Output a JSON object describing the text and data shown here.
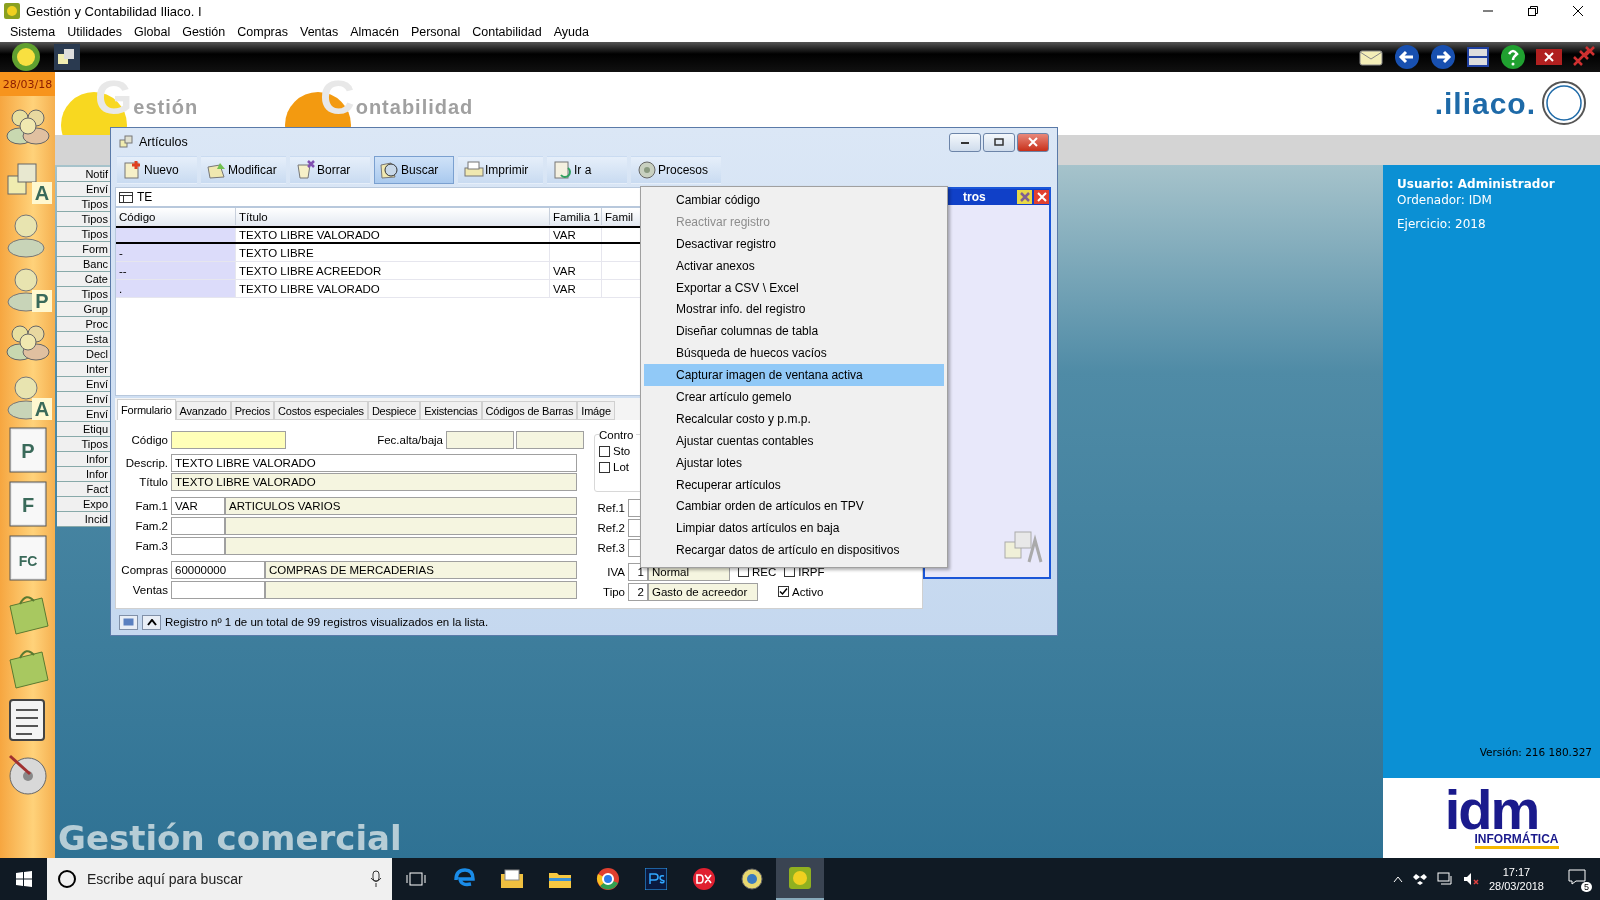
{
  "app_window": {
    "title": "Gestión y Contabilidad Iliaco. I"
  },
  "menu_bar": [
    "Sistema",
    "Utilidades",
    "Global",
    "Gestión",
    "Compras",
    "Ventas",
    "Almacén",
    "Personal",
    "Contabilidad",
    "Ayuda"
  ],
  "date": "28/03/18",
  "sidebar": [
    {
      "kind": "people"
    },
    {
      "kind": "cube",
      "letter": "A"
    },
    {
      "kind": "person"
    },
    {
      "kind": "person",
      "letter": "P"
    },
    {
      "kind": "people"
    },
    {
      "kind": "person",
      "letter": "A"
    },
    {
      "kind": "page",
      "letter": "P"
    },
    {
      "kind": "page",
      "letter": "F"
    },
    {
      "kind": "page",
      "letter": "FC"
    },
    {
      "kind": "bag"
    },
    {
      "kind": "bag"
    },
    {
      "kind": "list"
    },
    {
      "kind": "disc"
    }
  ],
  "header": {
    "logo_1": "Gestión",
    "logo_2": "Contabilidad",
    "brand": ".iliaco."
  },
  "background_list": [
    "Notif",
    "Enví",
    "Tipos",
    "Tipos",
    "Tipos",
    "Form",
    "Banc",
    "Cate",
    "Tipos",
    "Grup",
    "Proc",
    "Esta",
    "Decl",
    "Inter",
    "Enví",
    "Enví",
    "Enví",
    "Etiqu",
    "Tipos",
    "Infor",
    "Infor",
    "Fact",
    "Expo",
    "Incid"
  ],
  "info": {
    "user": "Usuario: Administrador",
    "computer": "Ordenador: IDM",
    "year": "Ejercicio: 2018",
    "version": "Versión: 216 180.327"
  },
  "company_logo": {
    "name": "idm",
    "tagline": "INFORMÁTICA"
  },
  "footer_title": "Gestión comercial",
  "articles_window": {
    "title": "Artículos",
    "toolbar": [
      {
        "label": "Nuevo",
        "kind": "new",
        "selected": false
      },
      {
        "label": "Modificar",
        "kind": "edit",
        "selected": false
      },
      {
        "label": "Borrar",
        "kind": "delete",
        "selected": false
      },
      {
        "label": "Buscar",
        "kind": "search",
        "selected": true
      },
      {
        "label": "Imprimir",
        "kind": "print",
        "selected": false
      },
      {
        "label": "Ir a",
        "kind": "goto",
        "selected": false
      },
      {
        "label": "Procesos",
        "kind": "gear",
        "selected": false
      }
    ],
    "search": {
      "value": "TE"
    },
    "table": {
      "columns": [
        "Código",
        "Título",
        "Familia 1",
        "Famil"
      ],
      "rows": [
        {
          "title": "TEXTO LIBRE VALORADO",
          "family": "VAR",
          "selected": true
        },
        {
          "code": "-",
          "title": "TEXTO LIBRE",
          "selected": false
        },
        {
          "code": "--",
          "title": "TEXTO LIBRE ACREEDOR",
          "family": "VAR",
          "selected": false
        },
        {
          "code": ".",
          "title": "TEXTO LIBRE VALORADO",
          "family": "VAR",
          "selected": false
        }
      ]
    },
    "tabs": [
      {
        "label": "Formulario",
        "selected": true
      },
      {
        "label": "Avanzado",
        "selected": false
      },
      {
        "label": "Precios",
        "selected": false
      },
      {
        "label": "Costos especiales",
        "selected": false
      },
      {
        "label": "Despiece",
        "selected": false
      },
      {
        "label": "Existencias",
        "selected": false
      },
      {
        "label": "Códigos de Barras",
        "selected": false
      },
      {
        "label": "Imáge",
        "selected": false
      }
    ],
    "form": {
      "code": {
        "label": "Código"
      },
      "dates": {
        "label": "Fec.alta/baja"
      },
      "description": {
        "label": "Descrip.",
        "value": "TEXTO LIBRE VALORADO"
      },
      "title": {
        "label": "Título",
        "value": "TEXTO LIBRE VALORADO"
      },
      "families": [
        {
          "label": "Fam.1",
          "code": "VAR",
          "name": "ARTICULOS VARIOS"
        },
        {
          "label": "Fam.2"
        },
        {
          "label": "Fam.3"
        }
      ],
      "accounts": [
        {
          "label": "Compras",
          "code": "60000000",
          "name": "COMPRAS DE MERCADERIAS"
        },
        {
          "label": "Ventas"
        }
      ],
      "control": {
        "title": "Contro",
        "checks": [
          {
            "label": "Sto",
            "checked": false
          },
          {
            "label": "Lot",
            "checked": false
          }
        ]
      },
      "refs": [
        "Ref.1",
        "Ref.2",
        "Ref.3"
      ],
      "iva": {
        "label": "IVA",
        "code": "1",
        "name": "Normal",
        "flags": [
          {
            "label": "REC",
            "checked": false
          },
          {
            "label": "IRPF",
            "checked": false
          }
        ]
      },
      "type": {
        "label": "Tipo",
        "code": "2",
        "name": "Gasto de acreedor",
        "flags": [
          {
            "label": "Activo",
            "checked": true
          }
        ]
      }
    },
    "status": "Registro nº 1 de un total de 99 registros visualizados en la lista.",
    "side_panel": {
      "title": "tros"
    }
  },
  "context_menu": [
    {
      "label": "Cambiar código",
      "disabled": false,
      "selected": false
    },
    {
      "label": "Reactivar registro",
      "disabled": true,
      "selected": false
    },
    {
      "label": "Desactivar registro",
      "disabled": false,
      "selected": false
    },
    {
      "label": "Activar anexos",
      "disabled": false,
      "selected": false
    },
    {
      "label": "Exportar a CSV \\ Excel",
      "disabled": false,
      "selected": false
    },
    {
      "label": "Mostrar info. del registro",
      "disabled": false,
      "selected": false
    },
    {
      "label": "Diseñar columnas de tabla",
      "disabled": false,
      "selected": false
    },
    {
      "label": "Búsqueda de huecos vacíos",
      "disabled": false,
      "selected": false
    },
    {
      "label": "Capturar imagen de ventana activa",
      "disabled": false,
      "selected": true
    },
    {
      "label": "Crear artículo gemelo",
      "disabled": false,
      "selected": false
    },
    {
      "label": "Recalcular costo y p.m.p.",
      "disabled": false,
      "selected": false
    },
    {
      "label": "Ajustar cuentas contables",
      "disabled": false,
      "selected": false
    },
    {
      "label": "Ajustar lotes",
      "disabled": false,
      "selected": false
    },
    {
      "label": "Recuperar artículos",
      "disabled": false,
      "selected": false
    },
    {
      "label": "Cambiar orden de artículos en TPV",
      "disabled": false,
      "selected": false
    },
    {
      "label": "Limpiar datos artículos en baja",
      "disabled": false,
      "selected": false
    },
    {
      "label": "Recargar datos de artículo en dispositivos",
      "disabled": false,
      "selected": false
    }
  ],
  "taskbar": {
    "search_placeholder": "Escribe aquí para buscar",
    "time": "17:17",
    "date": "28/03/2018",
    "notifications": "5"
  }
}
